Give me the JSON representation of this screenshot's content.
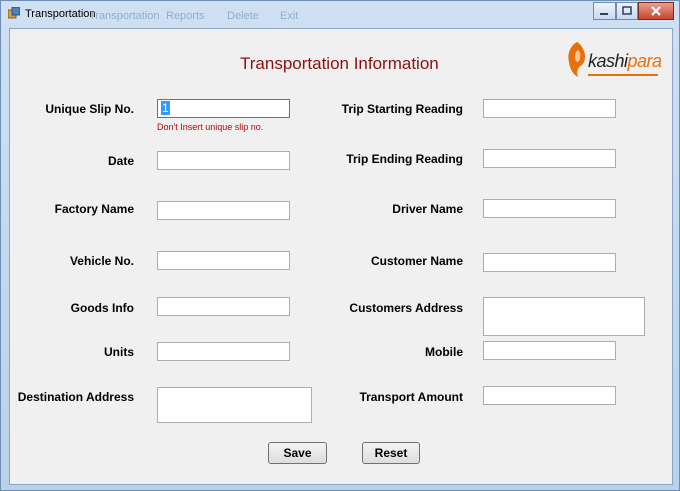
{
  "window": {
    "title": "Transportation",
    "ghost_menu": [
      "Transportation",
      "Reports",
      "Delete",
      "Exit"
    ]
  },
  "form": {
    "heading": "Transportation Information",
    "warning": "Don't Insert unique slip no.",
    "left_fields": [
      {
        "label": "Unique Slip No.",
        "value": "1"
      },
      {
        "label": "Date",
        "value": ""
      },
      {
        "label": "Factory Name",
        "value": ""
      },
      {
        "label": "Vehicle No.",
        "value": ""
      },
      {
        "label": "Goods Info",
        "value": ""
      },
      {
        "label": "Units",
        "value": ""
      },
      {
        "label": "Destination Address",
        "value": ""
      }
    ],
    "right_fields": [
      {
        "label": "Trip Starting Reading",
        "value": ""
      },
      {
        "label": "Trip Ending Reading",
        "value": ""
      },
      {
        "label": "Driver Name",
        "value": ""
      },
      {
        "label": "Customer Name",
        "value": ""
      },
      {
        "label": "Customers Address",
        "value": ""
      },
      {
        "label": "Mobile",
        "value": ""
      },
      {
        "label": "Transport Amount",
        "value": ""
      }
    ],
    "buttons": {
      "save": "Save",
      "reset": "Reset"
    }
  },
  "logo": {
    "text_kashi": "kashi",
    "text_para": "para",
    "brand_color": "#e8700a",
    "icon": "lion-head-icon"
  },
  "colors": {
    "heading": "#8b1010",
    "warning": "#c00000",
    "selection": "#3399ff"
  }
}
